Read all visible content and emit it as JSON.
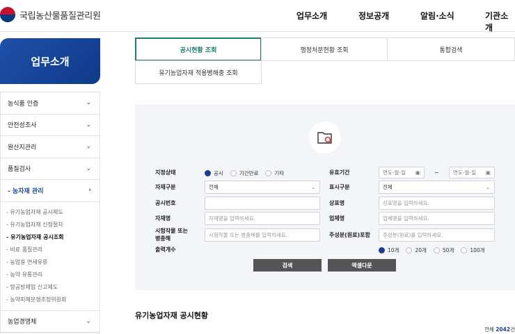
{
  "header": {
    "logo_text": "국립농산물품질관리원",
    "nav": [
      "업무소개",
      "정보공개",
      "알림·소식",
      "기관소개"
    ]
  },
  "sidebar": {
    "title": "업무소개",
    "items": [
      {
        "label": "농식품 인증"
      },
      {
        "label": "안전성조사"
      },
      {
        "label": "원산지관리"
      },
      {
        "label": "품질검사"
      },
      {
        "label": "- 농자재 관리"
      }
    ],
    "sub_items": [
      "- 유기농업자재 공시제도",
      "- 유기농업자재 신청절차",
      "- 유기농업자재 공시조회",
      "- 비료 품질관리",
      "- 농업용 면세유류",
      "- 농약 유통관리",
      "- 항공방제업 신고제도",
      "- 농약피해분쟁조정위원회"
    ],
    "last_item": "농업경영체"
  },
  "tabs": [
    "공시현황 조회",
    "행정처분현황 조회",
    "통합검색",
    "유기농업자재 적용병해충 조회"
  ],
  "form": {
    "status_label": "지정상태",
    "status_options": [
      "공시",
      "기간만료",
      "기타"
    ],
    "status_selected": "공시",
    "validity_label": "유효기간",
    "date_placeholder_from": "연도-월-일",
    "date_sep": "~",
    "date_placeholder_to": "연도-월-일",
    "material_type_label": "자재구분",
    "material_type_value": "전체",
    "display_type_label": "표시구분",
    "display_type_value": "전체",
    "notice_no_label": "공시번호",
    "notice_no_placeholder": "",
    "brand_label": "상표명",
    "brand_placeholder": "상표명을 입력하세요.",
    "material_name_label": "자재명",
    "material_name_placeholder": "자재명을 입력하세요.",
    "company_label": "업체명",
    "company_placeholder": "업체명을 입력하세요.",
    "crop_label_1": "시험작물 또는",
    "crop_label_2": "병충해",
    "crop_placeholder": "시험작물 또는 병충해를 입력하세요.",
    "ingredient_label": "주성분(원료)포함",
    "ingredient_placeholder": "주성분(원료)를 입력하세요.",
    "output_label": "출력개수",
    "output_options": [
      "10개",
      "20개",
      "50개",
      "100개"
    ],
    "output_selected": "10개",
    "search_button": "검색",
    "excel_button": "엑셀다운"
  },
  "result": {
    "title": "유기농업자재 공시현황",
    "count_prefix": "전체",
    "count": "2042",
    "count_suffix": "건"
  }
}
